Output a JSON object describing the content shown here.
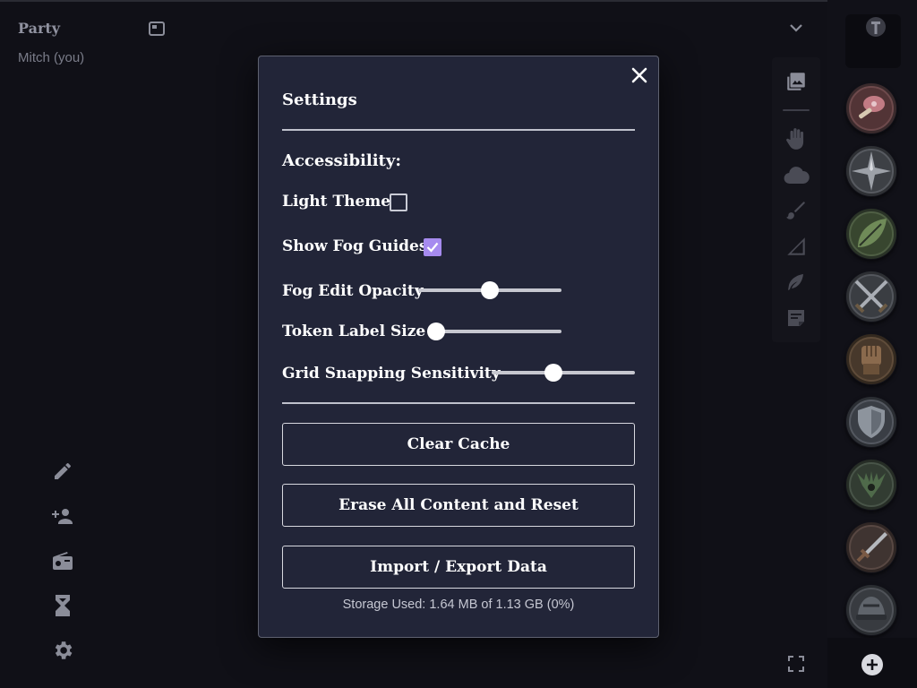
{
  "party": {
    "title": "Party",
    "members": [
      "Mitch (you)"
    ]
  },
  "left_tools": [
    "pencil-icon",
    "add-person-icon",
    "radio-icon",
    "hourglass-icon",
    "gear-icon"
  ],
  "map_tools": [
    "map-select-icon",
    "hand-icon",
    "fog-cloud-icon",
    "brush-icon",
    "measure-icon",
    "pointer-icon",
    "note-icon"
  ],
  "settings": {
    "title": "Settings",
    "accessibility_heading": "Accessibility:",
    "light_theme": {
      "label": "Light Theme",
      "checked": false
    },
    "show_fog_guides": {
      "label": "Show Fog Guides",
      "checked": true
    },
    "fog_edit_opacity": {
      "label": "Fog Edit Opacity",
      "value": 0.5
    },
    "token_label_size": {
      "label": "Token Label Size",
      "value": 0.0
    },
    "grid_snapping_sensitivity": {
      "label": "Grid Snapping Sensitivity",
      "value": 0.42
    },
    "buttons": {
      "clear_cache": "Clear Cache",
      "erase_reset": "Erase All Content and Reset",
      "import_export": "Import / Export Data"
    },
    "storage_text": "Storage Used: 1.64 MB of 1.13 GB (0%)"
  },
  "tokens": [
    "meat",
    "compass",
    "leaf",
    "crossed-swords",
    "fist",
    "shield",
    "antlers",
    "dagger",
    "helmet"
  ],
  "colors": {
    "accent": "#a68bef",
    "modal_bg": "#222538",
    "app_bg": "#101017"
  }
}
